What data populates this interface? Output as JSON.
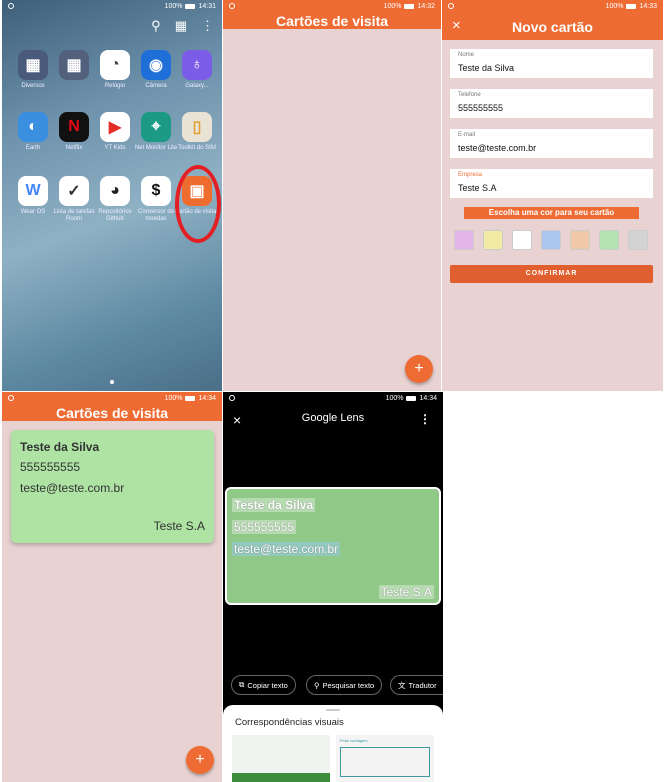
{
  "status": {
    "p1_time": "14:31",
    "p2_time": "14:32",
    "p3_time": "14:33",
    "p4_time": "14:34",
    "p5_time": "14:34",
    "battery": "100%"
  },
  "home": {
    "apps": [
      {
        "label": "Diversos",
        "icon": "folder-icon",
        "color": "#4a5a7a"
      },
      {
        "label": "",
        "icon": "folder-icon",
        "color": "#52607c"
      },
      {
        "label": "Relógio",
        "icon": "clock-icon",
        "color": "#ffffff"
      },
      {
        "label": "Câmera",
        "icon": "camera-icon",
        "color": "#1e6fd8"
      },
      {
        "label": "Galaxy...",
        "icon": "balloon-icon",
        "color": "#7b5ce6"
      },
      {
        "label": "Earth",
        "icon": "earth-icon",
        "color": "#3a8fe0"
      },
      {
        "label": "Netflix",
        "icon": "netflix-icon",
        "color": "#111111"
      },
      {
        "label": "YT Kids",
        "icon": "yt-kids-icon",
        "color": "#ffffff"
      },
      {
        "label": "Net Monitor Lite",
        "icon": "net-monitor-icon",
        "color": "#1d9a86"
      },
      {
        "label": "Toolkit do SIM",
        "icon": "sim-icon",
        "color": "#e9e3d6"
      },
      {
        "label": "Wear OS",
        "icon": "wear-os-icon",
        "color": "#ffffff"
      },
      {
        "label": "Lista de tarefas Room",
        "icon": "tasks-icon",
        "color": "#ffffff"
      },
      {
        "label": "Repositórios Github",
        "icon": "github-icon",
        "color": "#ffffff"
      },
      {
        "label": "Conversor de moedas",
        "icon": "dollar-icon",
        "color": "#ffffff"
      },
      {
        "label": "Cartão de visitas",
        "icon": "business-card-icon",
        "color": "#ef6c2f"
      }
    ]
  },
  "list_screen": {
    "title": "Cartões de visita",
    "fab_label": "+"
  },
  "form": {
    "title": "Novo cartão",
    "close_label": "×",
    "fields": [
      {
        "label": "Nome",
        "value": "Teste da Silva"
      },
      {
        "label": "Telefone",
        "value": "555555555"
      },
      {
        "label": "E-mail",
        "value": "teste@teste.com.br"
      },
      {
        "label": "Empresa",
        "value": "Teste S.A"
      }
    ],
    "color_prompt": "Escolha uma cor para seu cartão",
    "swatches": [
      "#e3b5e8",
      "#f2eba5",
      "#ffffff",
      "#aac6ef",
      "#f2c9a8",
      "#b3e3b0",
      "#d3d3d3"
    ],
    "confirm_label": "CONFIRMAR"
  },
  "card": {
    "name": "Teste da Silva",
    "phone": "555555555",
    "email": "teste@teste.com.br",
    "company": "Teste S.A",
    "color": "#aee3a4"
  },
  "lens": {
    "title": "Google Lens",
    "close_label": "×",
    "more_label": "⋮",
    "actions": [
      {
        "label": "Copiar texto",
        "icon": "copy-icon"
      },
      {
        "label": "Pesquisar texto",
        "icon": "search-icon"
      },
      {
        "label": "Tradutor",
        "icon": "translate-icon"
      }
    ],
    "sheet_title": "Correspondências visuais",
    "thumb_label": "Fiote contagem"
  },
  "colors": {
    "accent": "#ee6c34",
    "bg_pink": "#e9d2d2"
  }
}
